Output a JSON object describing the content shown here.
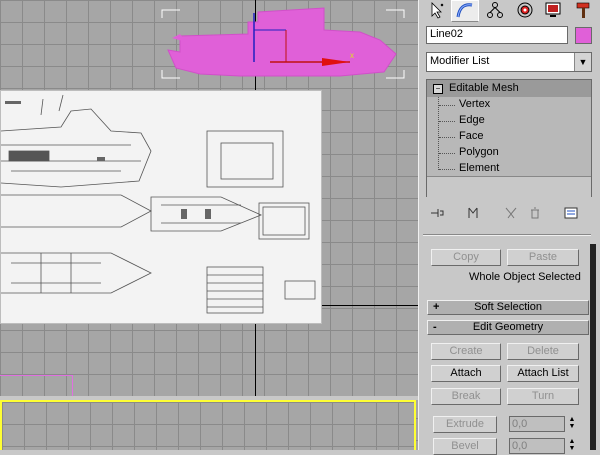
{
  "viewport": {
    "colors": {
      "object": "#e060d8",
      "grid": "#8a8a8a",
      "background": "#a6a6a6",
      "active_border": "#ffff33"
    }
  },
  "command_panel": {
    "tabs": [
      {
        "icon": "create-cursor-icon"
      },
      {
        "icon": "modify-arc-icon"
      },
      {
        "icon": "hierarchy-icon"
      },
      {
        "icon": "motion-icon"
      },
      {
        "icon": "display-monitor-icon"
      },
      {
        "icon": "utilities-hammer-icon"
      }
    ],
    "object_name": "Line02",
    "object_color": "#e060d8",
    "modifier_list": "Modifier List",
    "stack": {
      "base": "Editable Mesh",
      "expand_symbol": "⊟",
      "subobjects": [
        "Vertex",
        "Edge",
        "Face",
        "Polygon",
        "Element"
      ]
    },
    "selection": {
      "copy_label": "Copy",
      "paste_label": "Paste",
      "status": "Whole Object Selected"
    },
    "soft_selection": {
      "sign": "+",
      "title": "Soft Selection"
    },
    "edit_geometry": {
      "sign": "-",
      "title": "Edit Geometry",
      "create_label": "Create",
      "delete_label": "Delete",
      "attach_label": "Attach",
      "attach_list_label": "Attach List",
      "break_label": "Break",
      "turn_label": "Turn",
      "extrude_label": "Extrude",
      "extrude_value": "0,0",
      "bevel_label": "Bevel",
      "bevel_value": "0,0"
    }
  }
}
